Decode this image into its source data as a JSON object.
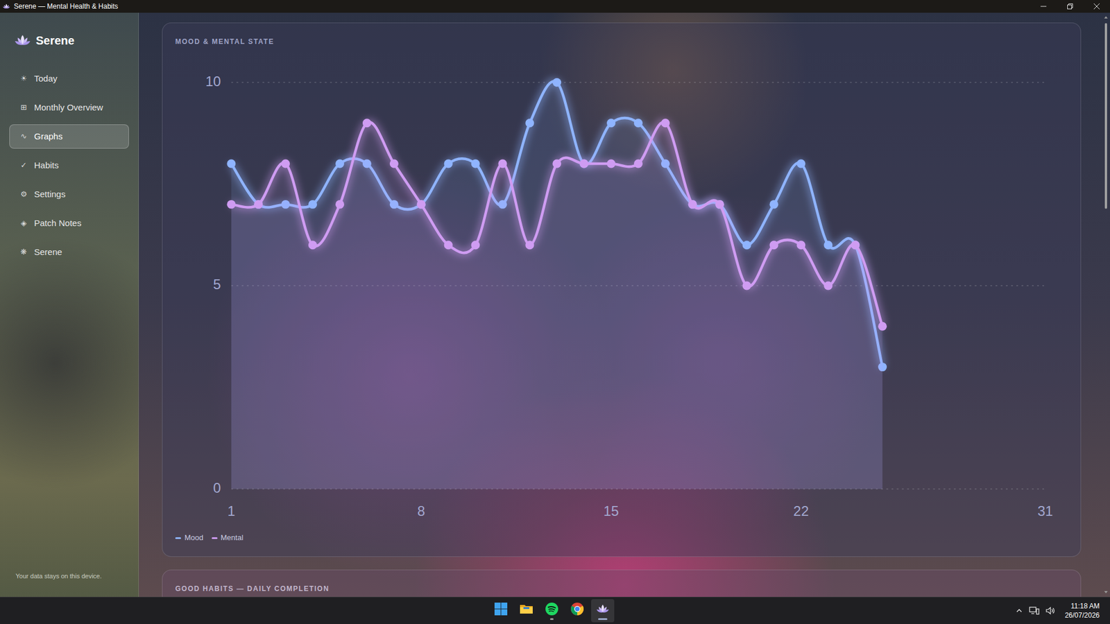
{
  "window": {
    "title": "Serene — Mental Health & Habits"
  },
  "app": {
    "name": "Serene"
  },
  "sidebar": {
    "items": [
      {
        "label": "Today",
        "icon": "☀",
        "selected": false
      },
      {
        "label": "Monthly Overview",
        "icon": "⊞",
        "selected": false
      },
      {
        "label": "Graphs",
        "icon": "∿",
        "selected": true
      },
      {
        "label": "Habits",
        "icon": "✓",
        "selected": false
      },
      {
        "label": "Settings",
        "icon": "⚙",
        "selected": false
      },
      {
        "label": "Patch Notes",
        "icon": "◈",
        "selected": false
      },
      {
        "label": "Serene",
        "icon": "❋",
        "selected": false
      }
    ],
    "footer": "Your data stays on this device."
  },
  "chart": {
    "title": "MOOD & MENTAL STATE",
    "y_ticks": [
      "10",
      "5",
      "0"
    ],
    "x_ticks": [
      "1",
      "8",
      "15",
      "22",
      "31"
    ],
    "series": [
      {
        "name": "Mood",
        "color": "#8fb4ff",
        "values": [
          8,
          7,
          7,
          7,
          8,
          8,
          7,
          7,
          8,
          8,
          7,
          9,
          10,
          8,
          9,
          9,
          8,
          7,
          7,
          6,
          7,
          8,
          6,
          6,
          3
        ]
      },
      {
        "name": "Mental",
        "color": "#cf9cf2",
        "values": [
          7,
          7,
          8,
          6,
          7,
          9,
          8,
          7,
          6,
          6,
          8,
          6,
          8,
          8,
          8,
          8,
          9,
          7,
          7,
          5,
          6,
          6,
          5,
          6,
          4
        ]
      }
    ]
  },
  "next_card": {
    "title": "GOOD HABITS — DAILY COMPLETION"
  },
  "scrollbar": {
    "level": 0.33
  },
  "taskbar": {
    "apps": [
      {
        "kind": "start",
        "running": false,
        "selected": false
      },
      {
        "kind": "explorer",
        "running": false,
        "selected": false
      },
      {
        "kind": "spotify",
        "running": true,
        "selected": false
      },
      {
        "kind": "chrome",
        "running": false,
        "selected": false
      },
      {
        "kind": "serene",
        "running": true,
        "selected": true
      }
    ],
    "time": "11:18 AM",
    "date": "26/07/2026"
  }
}
